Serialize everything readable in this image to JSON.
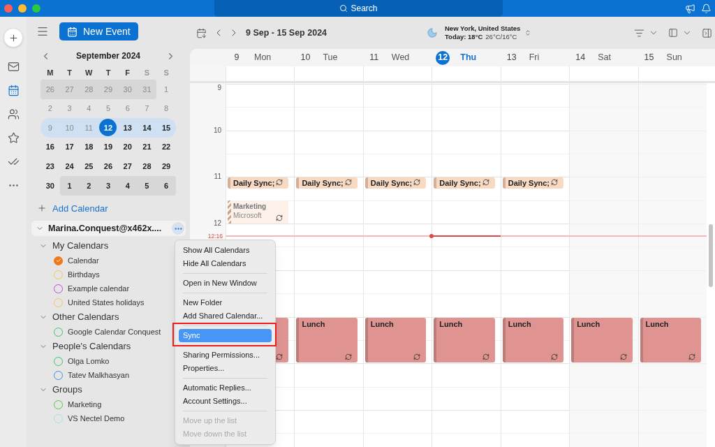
{
  "title_bar": {
    "search": "Search"
  },
  "rail": [
    {
      "kind": "mail",
      "selected": false
    },
    {
      "kind": "calendar",
      "selected": true
    },
    {
      "kind": "people",
      "selected": false
    },
    {
      "kind": "star",
      "selected": false
    },
    {
      "kind": "tasks",
      "selected": false
    },
    {
      "kind": "more",
      "selected": false
    }
  ],
  "new_event": "New Event",
  "mini_calendar": {
    "title": "September 2024",
    "weekdays": [
      {
        "label": "M",
        "weekend": false
      },
      {
        "label": "T",
        "weekend": false
      },
      {
        "label": "W",
        "weekend": false
      },
      {
        "label": "T",
        "weekend": false
      },
      {
        "label": "F",
        "weekend": false
      },
      {
        "label": "S",
        "weekend": true
      },
      {
        "label": "S",
        "weekend": true
      }
    ],
    "weeks": [
      {
        "selected": false,
        "days": [
          {
            "label": "26",
            "outside": true,
            "past": true,
            "today": false
          },
          {
            "label": "27",
            "outside": true,
            "past": true,
            "today": false
          },
          {
            "label": "28",
            "outside": true,
            "past": true,
            "today": false
          },
          {
            "label": "29",
            "outside": true,
            "past": true,
            "today": false
          },
          {
            "label": "30",
            "outside": true,
            "past": true,
            "today": false
          },
          {
            "label": "31",
            "outside": true,
            "past": true,
            "today": false
          },
          {
            "label": "1",
            "outside": false,
            "past": true,
            "today": false
          }
        ]
      },
      {
        "selected": false,
        "days": [
          {
            "label": "2",
            "outside": false,
            "past": true,
            "today": false
          },
          {
            "label": "3",
            "outside": false,
            "past": true,
            "today": false
          },
          {
            "label": "4",
            "outside": false,
            "past": true,
            "today": false
          },
          {
            "label": "5",
            "outside": false,
            "past": true,
            "today": false
          },
          {
            "label": "6",
            "outside": false,
            "past": true,
            "today": false
          },
          {
            "label": "7",
            "outside": false,
            "past": true,
            "today": false
          },
          {
            "label": "8",
            "outside": false,
            "past": true,
            "today": false
          }
        ]
      },
      {
        "selected": true,
        "days": [
          {
            "label": "9",
            "outside": false,
            "past": true,
            "today": false
          },
          {
            "label": "10",
            "outside": false,
            "past": true,
            "today": false
          },
          {
            "label": "11",
            "outside": false,
            "past": true,
            "today": false
          },
          {
            "label": "12",
            "outside": false,
            "past": false,
            "today": true
          },
          {
            "label": "13",
            "outside": false,
            "past": false,
            "today": false
          },
          {
            "label": "14",
            "outside": false,
            "past": false,
            "today": false
          },
          {
            "label": "15",
            "outside": false,
            "past": false,
            "today": false
          }
        ]
      },
      {
        "selected": false,
        "days": [
          {
            "label": "16",
            "outside": false,
            "past": false,
            "today": false
          },
          {
            "label": "17",
            "outside": false,
            "past": false,
            "today": false
          },
          {
            "label": "18",
            "outside": false,
            "past": false,
            "today": false
          },
          {
            "label": "19",
            "outside": false,
            "past": false,
            "today": false
          },
          {
            "label": "20",
            "outside": false,
            "past": false,
            "today": false
          },
          {
            "label": "21",
            "outside": false,
            "past": false,
            "today": false
          },
          {
            "label": "22",
            "outside": false,
            "past": false,
            "today": false
          }
        ]
      },
      {
        "selected": false,
        "days": [
          {
            "label": "23",
            "outside": false,
            "past": false,
            "today": false
          },
          {
            "label": "24",
            "outside": false,
            "past": false,
            "today": false
          },
          {
            "label": "25",
            "outside": false,
            "past": false,
            "today": false
          },
          {
            "label": "26",
            "outside": false,
            "past": false,
            "today": false
          },
          {
            "label": "27",
            "outside": false,
            "past": false,
            "today": false
          },
          {
            "label": "28",
            "outside": false,
            "past": false,
            "today": false
          },
          {
            "label": "29",
            "outside": false,
            "past": false,
            "today": false
          }
        ]
      },
      {
        "selected": false,
        "days": [
          {
            "label": "30",
            "outside": false,
            "past": false,
            "today": false
          },
          {
            "label": "1",
            "outside": true,
            "past": false,
            "today": false
          },
          {
            "label": "2",
            "outside": true,
            "past": false,
            "today": false
          },
          {
            "label": "3",
            "outside": true,
            "past": false,
            "today": false
          },
          {
            "label": "4",
            "outside": true,
            "past": false,
            "today": false
          },
          {
            "label": "5",
            "outside": true,
            "past": false,
            "today": false
          },
          {
            "label": "6",
            "outside": true,
            "past": false,
            "today": false
          }
        ]
      }
    ]
  },
  "add_calendar": "Add Calendar",
  "account": {
    "name": "Marina.Conquest@x462x....",
    "expanded": true
  },
  "calendar_groups": [
    {
      "name": "My Calendars",
      "expanded": true,
      "calendars": [
        {
          "name": "Calendar",
          "color": "#f07818",
          "checked": true
        },
        {
          "name": "Birthdays",
          "color": "#f2c94c",
          "checked": false
        },
        {
          "name": "Example calendar",
          "color": "#b44fc8",
          "checked": false
        },
        {
          "name": "United States holidays",
          "color": "#f2c94c",
          "checked": false
        }
      ]
    },
    {
      "name": "Other Calendars",
      "expanded": true,
      "calendars": [
        {
          "name": "Google Calendar Conquest",
          "color": "#3cc264",
          "checked": false
        }
      ]
    },
    {
      "name": "People's Calendars",
      "expanded": true,
      "calendars": [
        {
          "name": "Olga Lomko",
          "color": "#3cc264",
          "checked": false
        },
        {
          "name": "Tatev Malkhasyan",
          "color": "#3b8ee0",
          "checked": false
        }
      ]
    },
    {
      "name": "Groups",
      "expanded": true,
      "calendars": [
        {
          "name": "Marketing",
          "color": "#5cc04a",
          "checked": false
        },
        {
          "name": "VS Nectel Demo",
          "color": "#a9dcea",
          "checked": false
        }
      ]
    }
  ],
  "toolbar": {
    "date_range": "9 Sep - 15 Sep 2024",
    "weather": {
      "location": "New York, United States",
      "today": "Today: 18°C",
      "range": "26°C/16°C"
    }
  },
  "week_view": {
    "hour_labels": [
      "9",
      "10",
      "11",
      "12"
    ],
    "now": {
      "label": "12:16"
    },
    "days": [
      {
        "number": "9",
        "name": "Mon",
        "today": false,
        "weekend": false,
        "events": [
          {
            "kind": "busy",
            "title": "Daily Sync;",
            "recurring": true
          },
          {
            "kind": "tentative",
            "title": "Marketing",
            "subtitle": "Microsoft",
            "recurring": true
          },
          {
            "kind": "block",
            "recurring": true
          }
        ]
      },
      {
        "number": "10",
        "name": "Tue",
        "today": false,
        "weekend": false,
        "events": [
          {
            "kind": "busy",
            "title": "Daily Sync;",
            "recurring": true
          },
          {
            "kind": "block",
            "title": "Lunch",
            "recurring": true
          }
        ]
      },
      {
        "number": "11",
        "name": "Wed",
        "today": false,
        "weekend": false,
        "events": [
          {
            "kind": "busy",
            "title": "Daily Sync;",
            "recurring": true
          },
          {
            "kind": "block",
            "title": "Lunch",
            "recurring": true
          }
        ]
      },
      {
        "number": "12",
        "name": "Thu",
        "today": true,
        "weekend": false,
        "events": [
          {
            "kind": "busy",
            "title": "Daily Sync;",
            "recurring": true
          },
          {
            "kind": "block",
            "title": "Lunch",
            "recurring": true
          }
        ]
      },
      {
        "number": "13",
        "name": "Fri",
        "today": false,
        "weekend": false,
        "events": [
          {
            "kind": "busy",
            "title": "Daily Sync;",
            "recurring": true
          },
          {
            "kind": "block",
            "title": "Lunch",
            "recurring": true
          }
        ]
      },
      {
        "number": "14",
        "name": "Sat",
        "today": false,
        "weekend": true,
        "events": [
          {
            "kind": "block",
            "title": "Lunch",
            "recurring": true
          }
        ]
      },
      {
        "number": "15",
        "name": "Sun",
        "today": false,
        "weekend": true,
        "events": [
          {
            "kind": "block",
            "title": "Lunch",
            "recurring": true
          }
        ]
      }
    ]
  },
  "context_menu": {
    "groups": [
      {
        "items": [
          {
            "label": "Show All Calendars",
            "selected": false,
            "disabled": false,
            "framed": false
          },
          {
            "label": "Hide All Calendars",
            "selected": false,
            "disabled": false,
            "framed": false
          }
        ]
      },
      {
        "items": [
          {
            "label": "Open in New Window",
            "selected": false,
            "disabled": false,
            "framed": false
          }
        ]
      },
      {
        "items": [
          {
            "label": "New Folder",
            "selected": false,
            "disabled": false,
            "framed": false
          },
          {
            "label": "Add Shared Calendar...",
            "selected": false,
            "disabled": false,
            "framed": false
          }
        ]
      },
      {
        "items": [
          {
            "label": "Sync",
            "selected": true,
            "disabled": false,
            "framed": true
          }
        ]
      },
      {
        "items": [
          {
            "label": "Sharing Permissions...",
            "selected": false,
            "disabled": false,
            "framed": false
          },
          {
            "label": "Properties...",
            "selected": false,
            "disabled": false,
            "framed": false
          }
        ]
      },
      {
        "items": [
          {
            "label": "Automatic Replies...",
            "selected": false,
            "disabled": false,
            "framed": false
          },
          {
            "label": "Account Settings...",
            "selected": false,
            "disabled": false,
            "framed": false
          }
        ]
      },
      {
        "items": [
          {
            "label": "Move up the list",
            "selected": false,
            "disabled": true,
            "framed": false
          },
          {
            "label": "Move down the list",
            "selected": false,
            "disabled": true,
            "framed": false
          }
        ]
      }
    ]
  }
}
